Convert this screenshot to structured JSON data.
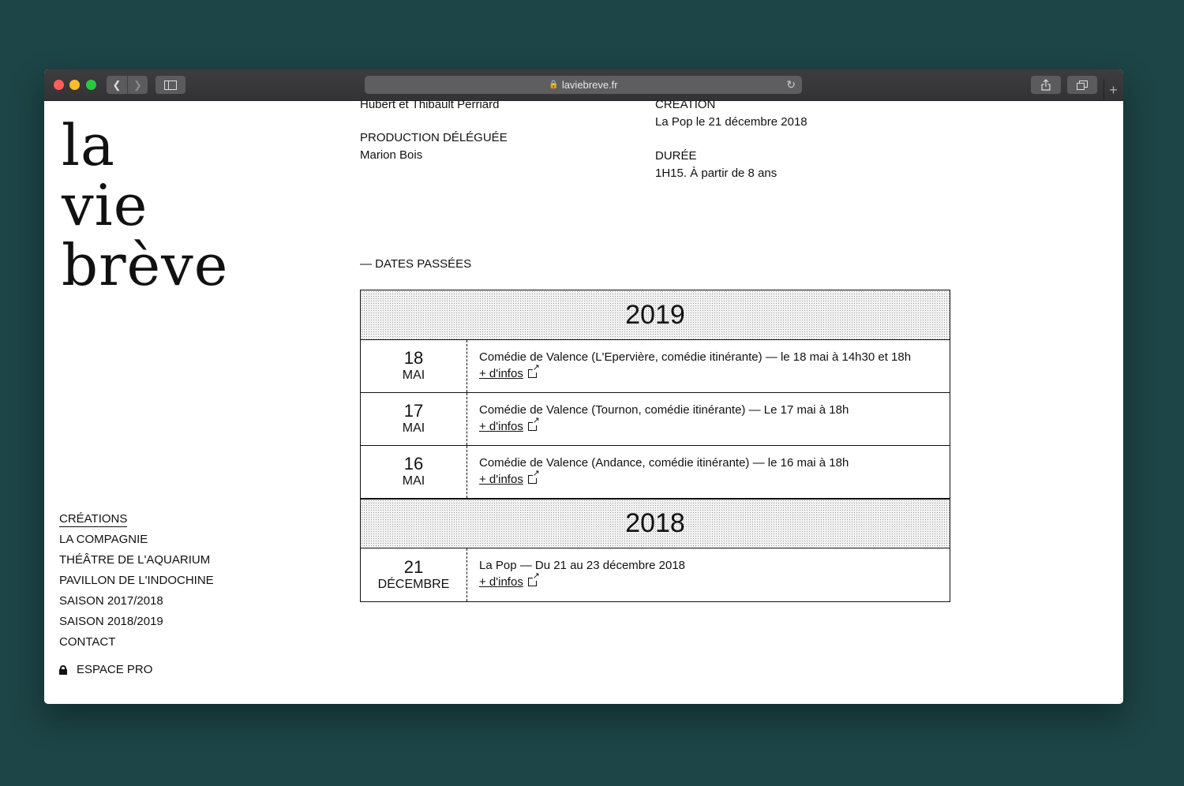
{
  "browser": {
    "url": "laviebreve.fr"
  },
  "logo": [
    "la",
    "vie",
    "brève"
  ],
  "info": {
    "credits_tail": "Hubert et Thibault Perriard",
    "production_label": "PRODUCTION DÉLÉGUÉE",
    "production_value": "Marion Bois",
    "creation_label": "CRÉATION",
    "creation_value": "La Pop le 21 décembre 2018",
    "duree_label": "DURÉE",
    "duree_value": "1H15. À partir de 8 ans"
  },
  "past_dates_title": "— DATES PASSÉES",
  "more_info_label": "+ d'infos",
  "dates": [
    {
      "year": "2019",
      "rows": [
        {
          "day": "18",
          "month": "MAI",
          "text": "Comédie de Valence (L'Epervière, comédie itinérante) — le 18 mai à 14h30 et 18h"
        },
        {
          "day": "17",
          "month": "MAI",
          "text": "Comédie de Valence (Tournon, comédie itinérante) — Le 17 mai à 18h"
        },
        {
          "day": "16",
          "month": "MAI",
          "text": "Comédie de Valence (Andance, comédie itinérante) — le 16 mai à 18h"
        }
      ]
    },
    {
      "year": "2018",
      "rows": [
        {
          "day": "21",
          "month": "DÉCEMBRE",
          "text": "La Pop — Du 21 au 23 décembre 2018"
        }
      ]
    }
  ],
  "menu": {
    "items": [
      "CRÉATIONS",
      "LA COMPAGNIE",
      "THÉÂTRE DE L'AQUARIUM",
      "PAVILLON DE L'INDOCHINE",
      "SAISON 2017/2018",
      "SAISON 2018/2019",
      "CONTACT"
    ],
    "espace_pro": "ESPACE PRO"
  }
}
